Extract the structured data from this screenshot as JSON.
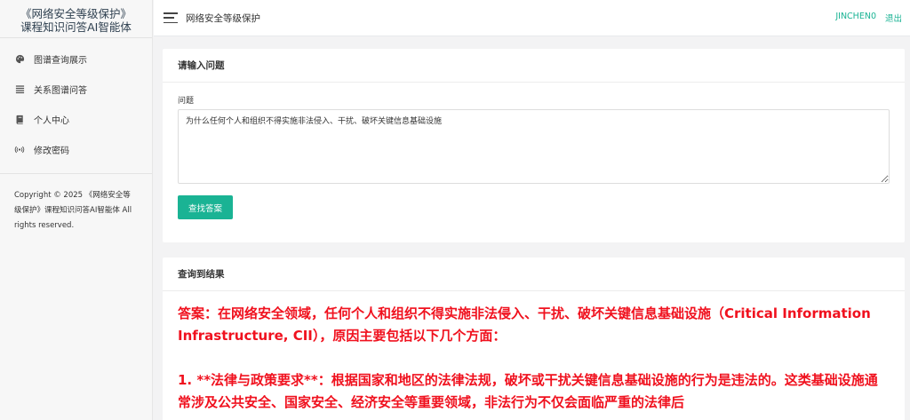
{
  "brand": {
    "line1": "《网络安全等级保护》",
    "line2": "课程知识问答AI智能体"
  },
  "sidebar": {
    "items": [
      {
        "label": "图谱查询展示",
        "icon": "palette-icon"
      },
      {
        "label": "关系图谱问答",
        "icon": "list-icon"
      },
      {
        "label": "个人中心",
        "icon": "book-icon"
      },
      {
        "label": "修改密码",
        "icon": "broadcast-icon"
      }
    ],
    "copyright": "Copyright © 2025 《网络安全等级保护》课程知识问答AI智能体 All rights reserved."
  },
  "topbar": {
    "title": "网络安全等级保护",
    "username": "JINCHEN0",
    "logout": "退出"
  },
  "question_panel": {
    "title": "请输入问题",
    "field_label": "问题",
    "value": "为什么任何个人和组织不得实施非法侵入、干扰、破坏关键信息基础设施",
    "button_label": "查找答案"
  },
  "result_panel": {
    "title": "查询到结果",
    "answer": "答案：在网络安全领域，任何个人和组织不得实施非法侵入、干扰、破坏关键信息基础设施（Critical Information Infrastructure, CII），原因主要包括以下几个方面：\n\n1. **法律与政策要求**：根据国家和地区的法律法规，破坏或干扰关键信息基础设施的行为是违法的。这类基础设施通常涉及公共安全、国家安全、经济安全等重要领域，非法行为不仅会面临严重的法律后"
  },
  "colors": {
    "accent": "#1ab394",
    "answer_red": "#f0111e",
    "brand_text": "#2f4050"
  }
}
